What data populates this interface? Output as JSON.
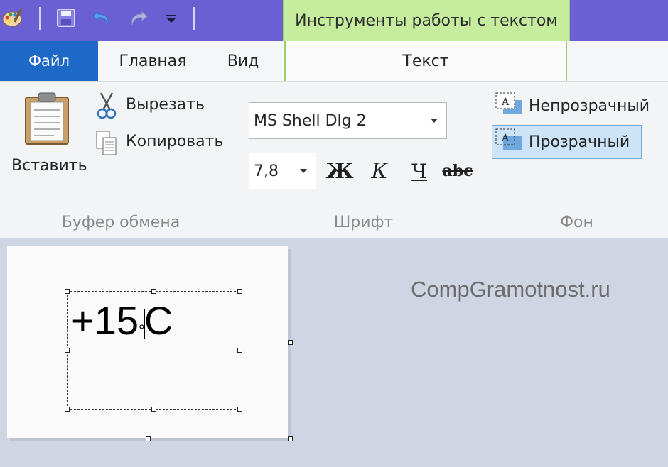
{
  "quick_access": {
    "icons": [
      "paint-app-icon",
      "save-icon",
      "undo-icon",
      "redo-icon",
      "customize-dropdown-icon"
    ]
  },
  "context_header": "Инструменты работы с текстом",
  "tabs": {
    "file": "Файл",
    "home": "Главная",
    "view": "Вид",
    "text": "Текст"
  },
  "clipboard": {
    "paste": "Вставить",
    "cut": "Вырезать",
    "copy": "Копировать",
    "group": "Буфер обмена"
  },
  "font": {
    "family": "MS Shell Dlg 2",
    "size": "7,8",
    "bold": "Ж",
    "italic": "К",
    "underline": "Ч",
    "strike": "abc",
    "group": "Шрифт"
  },
  "background": {
    "opaque": "Непрозрачный",
    "transparent": "Прозрачный",
    "selected": "transparent",
    "group": "Фон"
  },
  "canvas": {
    "text_before": "+15",
    "degree": "°",
    "text_after": "C",
    "watermark": "CompGramotnost.ru"
  },
  "colors": {
    "title_bar": "#6b5fd4",
    "context_tab": "#c6ec9e",
    "file_tab": "#1e68c7",
    "selected_option": "#cde3f7"
  }
}
